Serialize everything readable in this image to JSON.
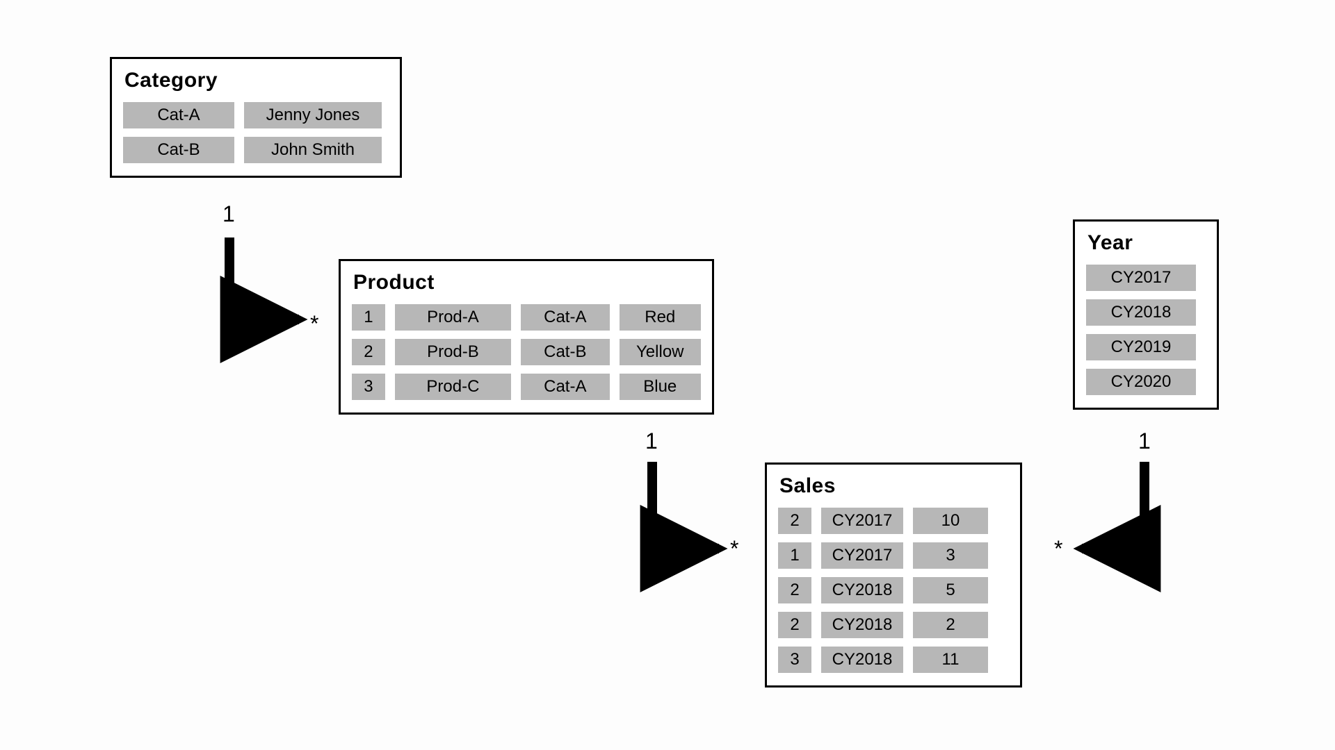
{
  "entities": {
    "category": {
      "title": "Category",
      "rows": [
        [
          "Cat-A",
          "Jenny Jones"
        ],
        [
          "Cat-B",
          "John Smith"
        ]
      ]
    },
    "product": {
      "title": "Product",
      "rows": [
        [
          "1",
          "Prod-A",
          "Cat-A",
          "Red"
        ],
        [
          "2",
          "Prod-B",
          "Cat-B",
          "Yellow"
        ],
        [
          "3",
          "Prod-C",
          "Cat-A",
          "Blue"
        ]
      ]
    },
    "year": {
      "title": "Year",
      "rows": [
        [
          "CY2017"
        ],
        [
          "CY2018"
        ],
        [
          "CY2019"
        ],
        [
          "CY2020"
        ]
      ]
    },
    "sales": {
      "title": "Sales",
      "rows": [
        [
          "2",
          "CY2017",
          "10"
        ],
        [
          "1",
          "CY2017",
          "3"
        ],
        [
          "2",
          "CY2018",
          "5"
        ],
        [
          "2",
          "CY2018",
          "2"
        ],
        [
          "3",
          "CY2018",
          "11"
        ]
      ]
    }
  },
  "cardinality": {
    "one": "1",
    "many": "*"
  }
}
